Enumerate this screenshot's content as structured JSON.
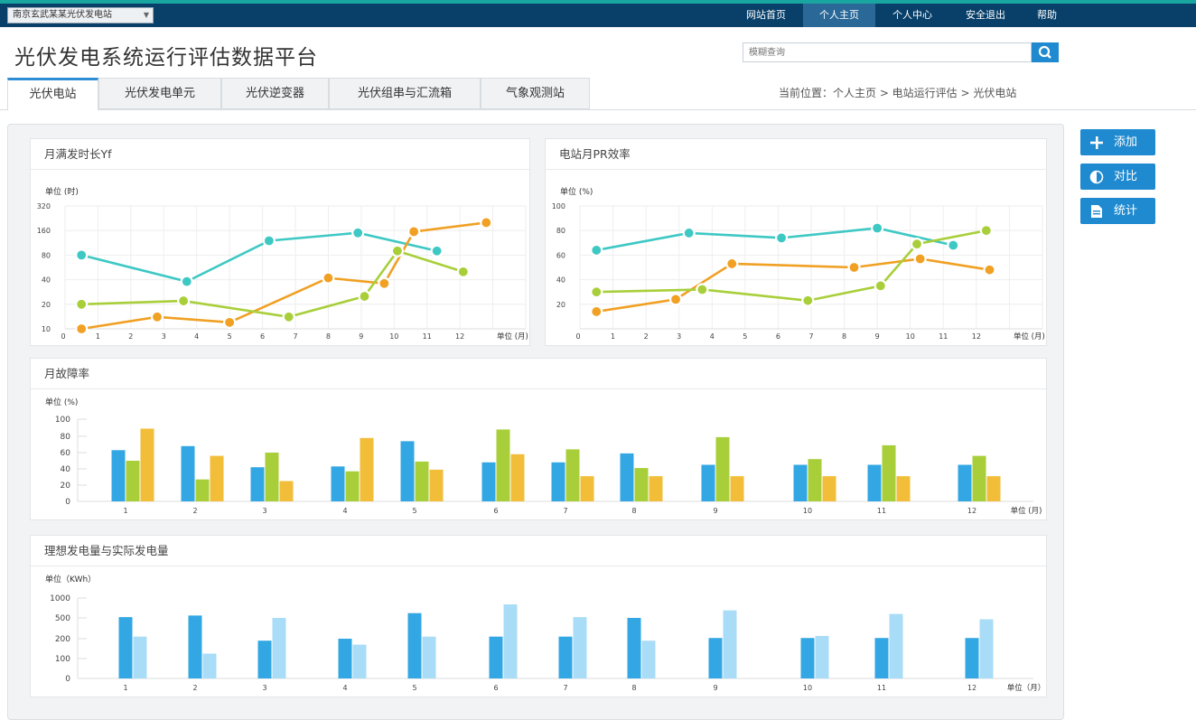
{
  "topbar": {
    "station_select": "南京玄武某某光伏发电站",
    "nav": [
      "网站首页",
      "个人主页",
      "个人中心",
      "安全退出",
      "帮助"
    ]
  },
  "header": {
    "title": "光伏发电系统运行评估数据平台",
    "search_placeholder": "模糊查询"
  },
  "tabs": [
    "光伏电站",
    "光伏发电单元",
    "光伏逆变器",
    "光伏组串与汇流箱",
    "气象观测站"
  ],
  "breadcrumb": "当前位置：个人主页 > 电站运行评估 > 光伏电站",
  "side_buttons": [
    "添加",
    "对比",
    "统计"
  ],
  "colors": {
    "accent": "#1f8ad0",
    "teal": "#3ec8c4",
    "orange": "#f0a023",
    "green": "#a8cf3a",
    "blue": "#32a7e4",
    "lightblue": "#a9dcf7"
  },
  "chart_data": [
    {
      "type": "line",
      "title": "月满发时长Yf",
      "unit_label": "单位 (时)",
      "x_unit": "单位 (月)",
      "x_ticks": [
        "0",
        "1",
        "2",
        "3",
        "4",
        "5",
        "6",
        "7",
        "8",
        "9",
        "10",
        "11",
        "12"
      ],
      "y_ticks": [
        "10",
        "20",
        "40",
        "80",
        "160",
        "320"
      ],
      "series": [
        {
          "color": "#3ec8c4",
          "points": [
            [
              0.5,
              80
            ],
            [
              3.7,
              38
            ],
            [
              6.2,
              120
            ],
            [
              8.9,
              150
            ],
            [
              11.3,
              90
            ]
          ]
        },
        {
          "color": "#f0a023",
          "points": [
            [
              0.5,
              10
            ],
            [
              2.8,
              14
            ],
            [
              5.0,
              12
            ],
            [
              8.0,
              42
            ],
            [
              9.7,
              36
            ],
            [
              10.6,
              155
            ],
            [
              12.8,
              200
            ]
          ]
        },
        {
          "color": "#a8cf3a",
          "points": [
            [
              0.5,
              20
            ],
            [
              3.6,
              22
            ],
            [
              6.8,
              14
            ],
            [
              9.1,
              25
            ],
            [
              10.1,
              90
            ],
            [
              12.1,
              50
            ]
          ]
        }
      ]
    },
    {
      "type": "line",
      "title": "电站月PR效率",
      "unit_label": "单位 (%)",
      "x_unit": "单位 (月)",
      "x_ticks": [
        "0",
        "1",
        "2",
        "3",
        "4",
        "5",
        "6",
        "7",
        "8",
        "9",
        "10",
        "11",
        "12"
      ],
      "y_ticks": [
        "20",
        "40",
        "60",
        "80",
        "100"
      ],
      "series": [
        {
          "color": "#3ec8c4",
          "points": [
            [
              0.5,
              64
            ],
            [
              3.3,
              78
            ],
            [
              6.1,
              74
            ],
            [
              9.0,
              82
            ],
            [
              11.3,
              68
            ]
          ]
        },
        {
          "color": "#f0a023",
          "points": [
            [
              0.5,
              14
            ],
            [
              2.9,
              24
            ],
            [
              4.6,
              53
            ],
            [
              8.3,
              50
            ],
            [
              10.3,
              57
            ],
            [
              12.4,
              48
            ]
          ]
        },
        {
          "color": "#a8cf3a",
          "points": [
            [
              0.5,
              30
            ],
            [
              3.7,
              32
            ],
            [
              6.9,
              23
            ],
            [
              9.1,
              35
            ],
            [
              10.2,
              69
            ],
            [
              12.3,
              80
            ]
          ]
        }
      ]
    },
    {
      "type": "bar",
      "title": "月故障率",
      "unit_label": "单位 (%)",
      "x_unit": "单位 (月)",
      "categories": [
        "1",
        "2",
        "3",
        "4",
        "5",
        "6",
        "7",
        "8",
        "9",
        "10",
        "11",
        "12"
      ],
      "y_ticks": [
        "0",
        "20",
        "40",
        "60",
        "80",
        "100"
      ],
      "series": [
        {
          "color": "#32a7e4",
          "values": [
            63,
            68,
            42,
            43,
            74,
            48,
            48,
            59,
            45,
            45,
            45,
            45
          ]
        },
        {
          "color": "#a8cf3a",
          "values": [
            50,
            27,
            60,
            37,
            49,
            88,
            64,
            41,
            79,
            52,
            69,
            56
          ]
        },
        {
          "color": "#f2be3a",
          "values": [
            89,
            56,
            25,
            78,
            39,
            58,
            31,
            31,
            31,
            31,
            31,
            31
          ]
        }
      ]
    },
    {
      "type": "bar",
      "title": "理想发电量与实际发电量",
      "unit_label": "单位（KWh）",
      "x_unit": "单位（月）",
      "categories": [
        "1",
        "2",
        "3",
        "4",
        "5",
        "6",
        "7",
        "8",
        "9",
        "10",
        "11",
        "12"
      ],
      "y_ticks": [
        "0",
        "100",
        "200",
        "500",
        "1000"
      ],
      "series": [
        {
          "color": "#32a7e4",
          "values": [
            520,
            560,
            190,
            200,
            620,
            230,
            230,
            500,
            210,
            210,
            210,
            210
          ]
        },
        {
          "color": "#a9dcf7",
          "values": [
            230,
            125,
            500,
            170,
            230,
            840,
            520,
            190,
            690,
            240,
            600,
            480
          ]
        }
      ]
    }
  ]
}
